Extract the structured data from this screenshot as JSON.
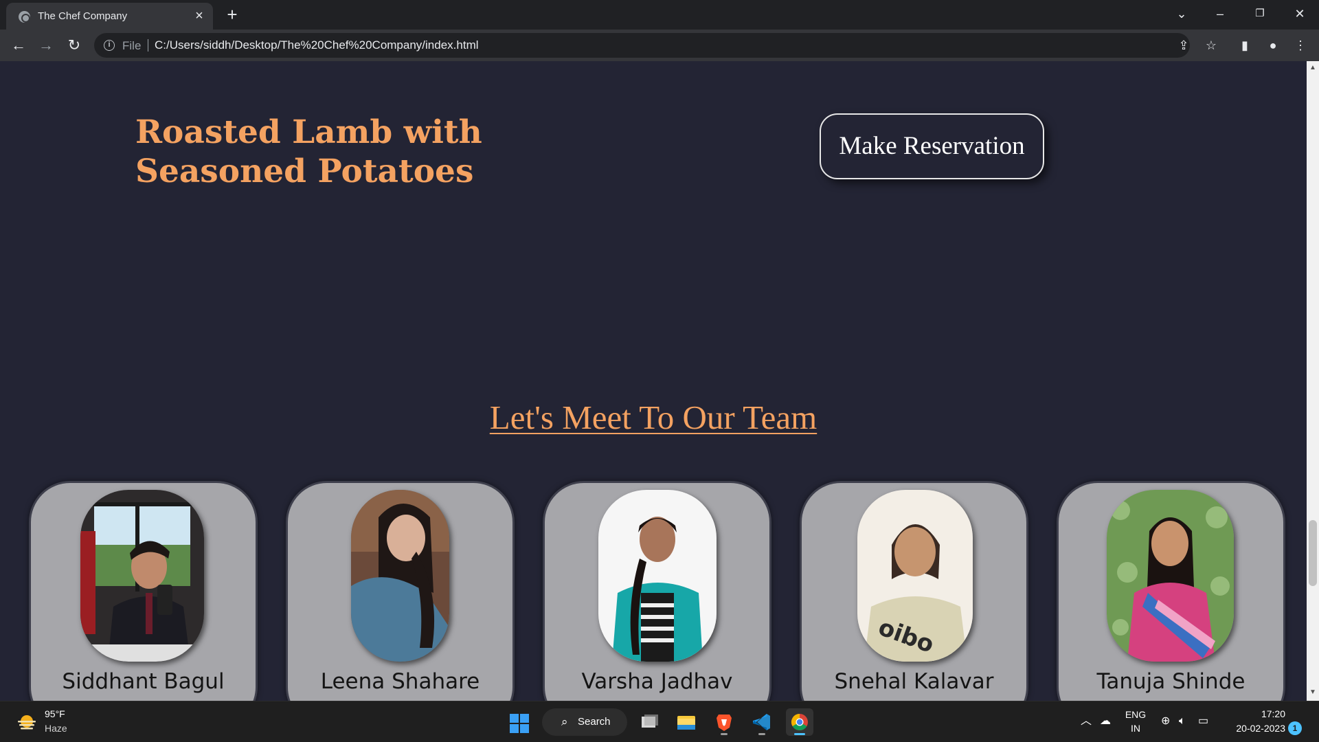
{
  "browser": {
    "tab_title": "The Chef Company",
    "url_scheme": "File",
    "url": "C:/Users/siddh/Desktop/The%20Chef%20Company/index.html"
  },
  "page": {
    "dish_title": "Roasted Lamb with Seasoned Potatoes",
    "reserve_label": "Make Reservation",
    "team_heading": "Let's Meet To Our Team",
    "team": [
      {
        "name": "Siddhant Bagul"
      },
      {
        "name": "Leena Shahare"
      },
      {
        "name": "Varsha Jadhav"
      },
      {
        "name": "Snehal Kalavar"
      },
      {
        "name": "Tanuja Shinde"
      }
    ],
    "colors": {
      "accent": "#f4a261",
      "background": "#232434",
      "card": "#a6a6aa"
    }
  },
  "taskbar": {
    "temperature": "95°F",
    "condition": "Haze",
    "search_label": "Search",
    "lang_top": "ENG",
    "lang_bottom": "IN",
    "time": "17:20",
    "date": "20-02-2023",
    "notification_count": "1"
  }
}
